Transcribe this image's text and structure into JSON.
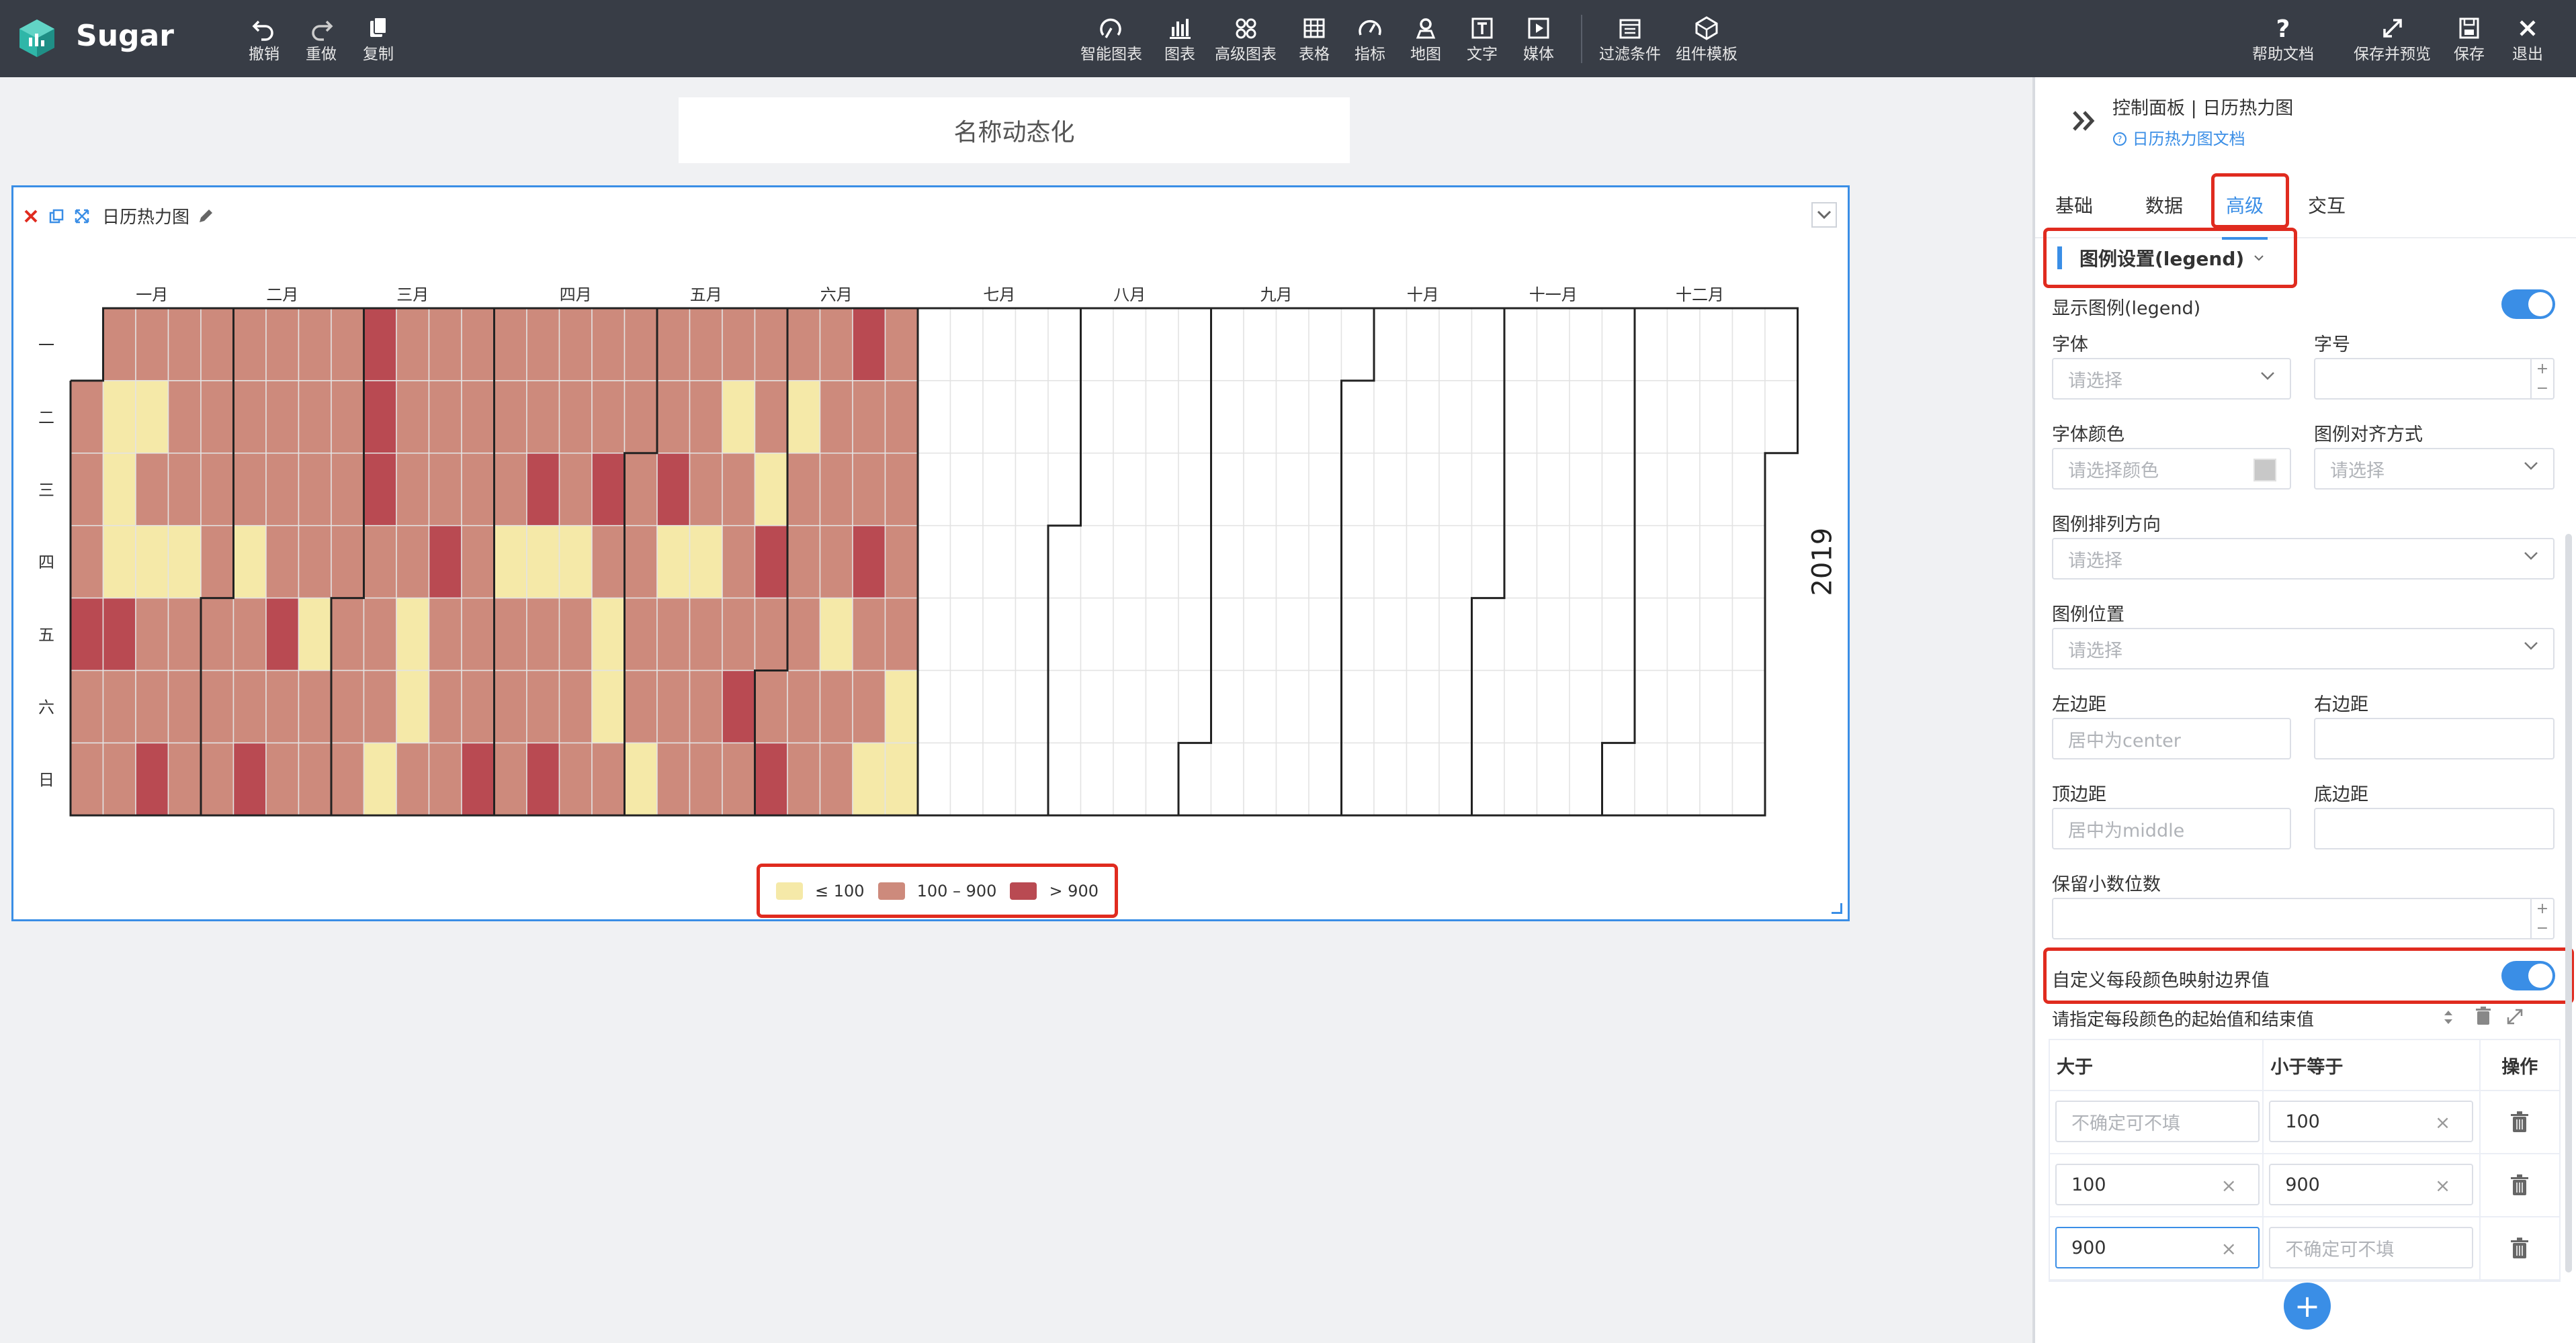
{
  "app": {
    "brand": "Sugar"
  },
  "toolbar": {
    "left": [
      {
        "icon": "undo-icon",
        "label": "撤销"
      },
      {
        "icon": "redo-icon",
        "label": "重做"
      },
      {
        "icon": "copy-icon",
        "label": "复制"
      }
    ],
    "center": [
      {
        "icon": "smart-chart-icon",
        "label": "智能图表"
      },
      {
        "icon": "bar-chart-icon",
        "label": "图表"
      },
      {
        "icon": "advanced-chart-icon",
        "label": "高级图表"
      },
      {
        "icon": "table-icon",
        "label": "表格"
      },
      {
        "icon": "gauge-icon",
        "label": "指标"
      },
      {
        "icon": "map-pin-icon",
        "label": "地图"
      },
      {
        "icon": "text-icon",
        "label": "文字"
      },
      {
        "icon": "media-play-icon",
        "label": "媒体"
      },
      {
        "icon": "filter-icon",
        "label": "过滤条件"
      },
      {
        "icon": "template-icon",
        "label": "组件模板"
      }
    ],
    "right": [
      {
        "icon": "help-icon",
        "label": "帮助文档"
      },
      {
        "icon": "expand-icon",
        "label": "保存并预览"
      },
      {
        "icon": "save-icon",
        "label": "保存"
      },
      {
        "icon": "close-icon",
        "label": "退出"
      }
    ]
  },
  "canvas": {
    "title_text": "名称动态化"
  },
  "widget": {
    "name": "日历热力图"
  },
  "chart_data": {
    "type": "heatmap",
    "year": "2019",
    "month_labels": [
      "一月",
      "二月",
      "三月",
      "四月",
      "五月",
      "六月",
      "七月",
      "八月",
      "九月",
      "十月",
      "十一月",
      "十二月"
    ],
    "day_labels": [
      "一",
      "二",
      "三",
      "四",
      "五",
      "六",
      "日"
    ],
    "data_through": "2019-06-30",
    "low_days": [
      "01-08",
      "01-09",
      "01-10",
      "01-15",
      "01-17",
      "01-24",
      "02-07",
      "02-22",
      "03-10",
      "03-15",
      "03-16",
      "04-04",
      "04-11",
      "04-18",
      "04-26",
      "04-27",
      "05-05",
      "05-09",
      "05-16",
      "05-21",
      "05-29",
      "06-04",
      "06-14",
      "06-23",
      "06-29",
      "06-30"
    ],
    "high_days": [
      "01-04",
      "01-11",
      "01-20",
      "02-10",
      "02-15",
      "03-04",
      "03-05",
      "03-06",
      "03-21",
      "03-31",
      "04-10",
      "04-14",
      "04-24",
      "05-08",
      "05-25",
      "05-30",
      "06-02",
      "06-17",
      "06-20"
    ],
    "legend": [
      {
        "label": "≤ 100",
        "color": "#f5e9a8"
      },
      {
        "label": "100 – 900",
        "color": "#cd8a7c"
      },
      {
        "label": "> 900",
        "color": "#b94a52"
      }
    ]
  },
  "panel": {
    "title": "控制面板 | 日历热力图",
    "doc_link": "日历热力图文档",
    "tabs": [
      {
        "label": "基础"
      },
      {
        "label": "数据"
      },
      {
        "label": "高级"
      },
      {
        "label": "交互"
      }
    ],
    "active_tab": "高级",
    "section_title": "图例设置(legend)",
    "show_legend_label": "显示图例(legend)",
    "font_label": "字体",
    "font_placeholder": "请选择",
    "size_label": "字号",
    "font_color_label": "字体颜色",
    "font_color_placeholder": "请选择颜色",
    "align_label": "图例对齐方式",
    "align_placeholder": "请选择",
    "orient_label": "图例排列方向",
    "orient_placeholder": "请选择",
    "position_label": "图例位置",
    "position_placeholder": "请选择",
    "left_label": "左边距",
    "left_placeholder": "居中为center",
    "right_label": "右边距",
    "top_label": "顶边距",
    "top_placeholder": "居中为middle",
    "bottom_label": "底边距",
    "decimals_label": "保留小数位数",
    "custom_label": "自定义每段颜色映射边界值",
    "range_hint": "请指定每段颜色的起始值和结束值",
    "col_gt": "大于",
    "col_lte": "小于等于",
    "col_op": "操作",
    "optional_placeholder": "不确定可不填",
    "rows": [
      {
        "gt": "",
        "lte": "100"
      },
      {
        "gt": "100",
        "lte": "900"
      },
      {
        "gt": "900",
        "lte": ""
      }
    ],
    "add_symbol": "+"
  }
}
